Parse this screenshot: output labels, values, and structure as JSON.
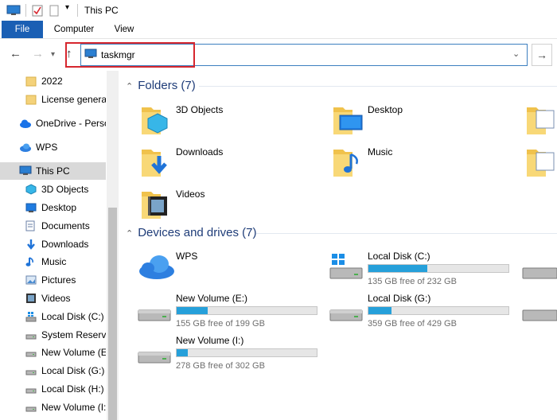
{
  "window": {
    "title": "This PC"
  },
  "ribbon": {
    "tabs": [
      "File",
      "Computer",
      "View"
    ]
  },
  "address": {
    "path": "taskmgr"
  },
  "sidebar": {
    "items": [
      {
        "label": "2022",
        "icon": "folder-icon"
      },
      {
        "label": "License generate",
        "icon": "folder-icon"
      },
      {
        "label": "OneDrive - Person",
        "icon": "onedrive-icon"
      },
      {
        "label": "WPS",
        "icon": "wps-cloud-icon"
      },
      {
        "label": "This PC",
        "icon": "this-pc-icon",
        "selected": true
      },
      {
        "label": "3D Objects",
        "icon": "3d-objects-icon"
      },
      {
        "label": "Desktop",
        "icon": "desktop-icon"
      },
      {
        "label": "Documents",
        "icon": "documents-icon"
      },
      {
        "label": "Downloads",
        "icon": "downloads-icon"
      },
      {
        "label": "Music",
        "icon": "music-icon"
      },
      {
        "label": "Pictures",
        "icon": "pictures-icon"
      },
      {
        "label": "Videos",
        "icon": "videos-icon"
      },
      {
        "label": "Local Disk (C:)",
        "icon": "drive-c-icon"
      },
      {
        "label": "System Reserved",
        "icon": "drive-icon"
      },
      {
        "label": "New Volume (E:)",
        "icon": "drive-icon"
      },
      {
        "label": "Local Disk (G:)",
        "icon": "drive-icon"
      },
      {
        "label": "Local Disk (H:)",
        "icon": "drive-icon"
      },
      {
        "label": "New Volume (I:)",
        "icon": "drive-icon"
      }
    ]
  },
  "folders": {
    "heading": "Folders (7)",
    "items": [
      {
        "label": "3D Objects",
        "icon": "3d-objects-icon"
      },
      {
        "label": "Desktop",
        "icon": "desktop-icon"
      },
      {
        "label": "Downloads",
        "icon": "downloads-icon"
      },
      {
        "label": "Music",
        "icon": "music-icon"
      },
      {
        "label": "Videos",
        "icon": "videos-icon"
      }
    ]
  },
  "drives": {
    "heading": "Devices and drives (7)",
    "items": [
      {
        "label": "WPS",
        "icon": "wps-cloud-icon"
      },
      {
        "label": "Local Disk (C:)",
        "free": "135 GB free of 232 GB",
        "used_fraction": 0.418
      },
      {
        "label": "New Volume (E:)",
        "free": "155 GB free of 199 GB",
        "used_fraction": 0.221
      },
      {
        "label": "Local Disk (G:)",
        "free": "359 GB free of 429 GB",
        "used_fraction": 0.163
      },
      {
        "label": "New Volume (I:)",
        "free": "278 GB free of 302 GB",
        "used_fraction": 0.079
      }
    ]
  },
  "colors": {
    "accent": "#1a5fb4",
    "bar_fill": "#26a0da",
    "highlight": "#d6262e",
    "heading": "#1e3c78"
  }
}
